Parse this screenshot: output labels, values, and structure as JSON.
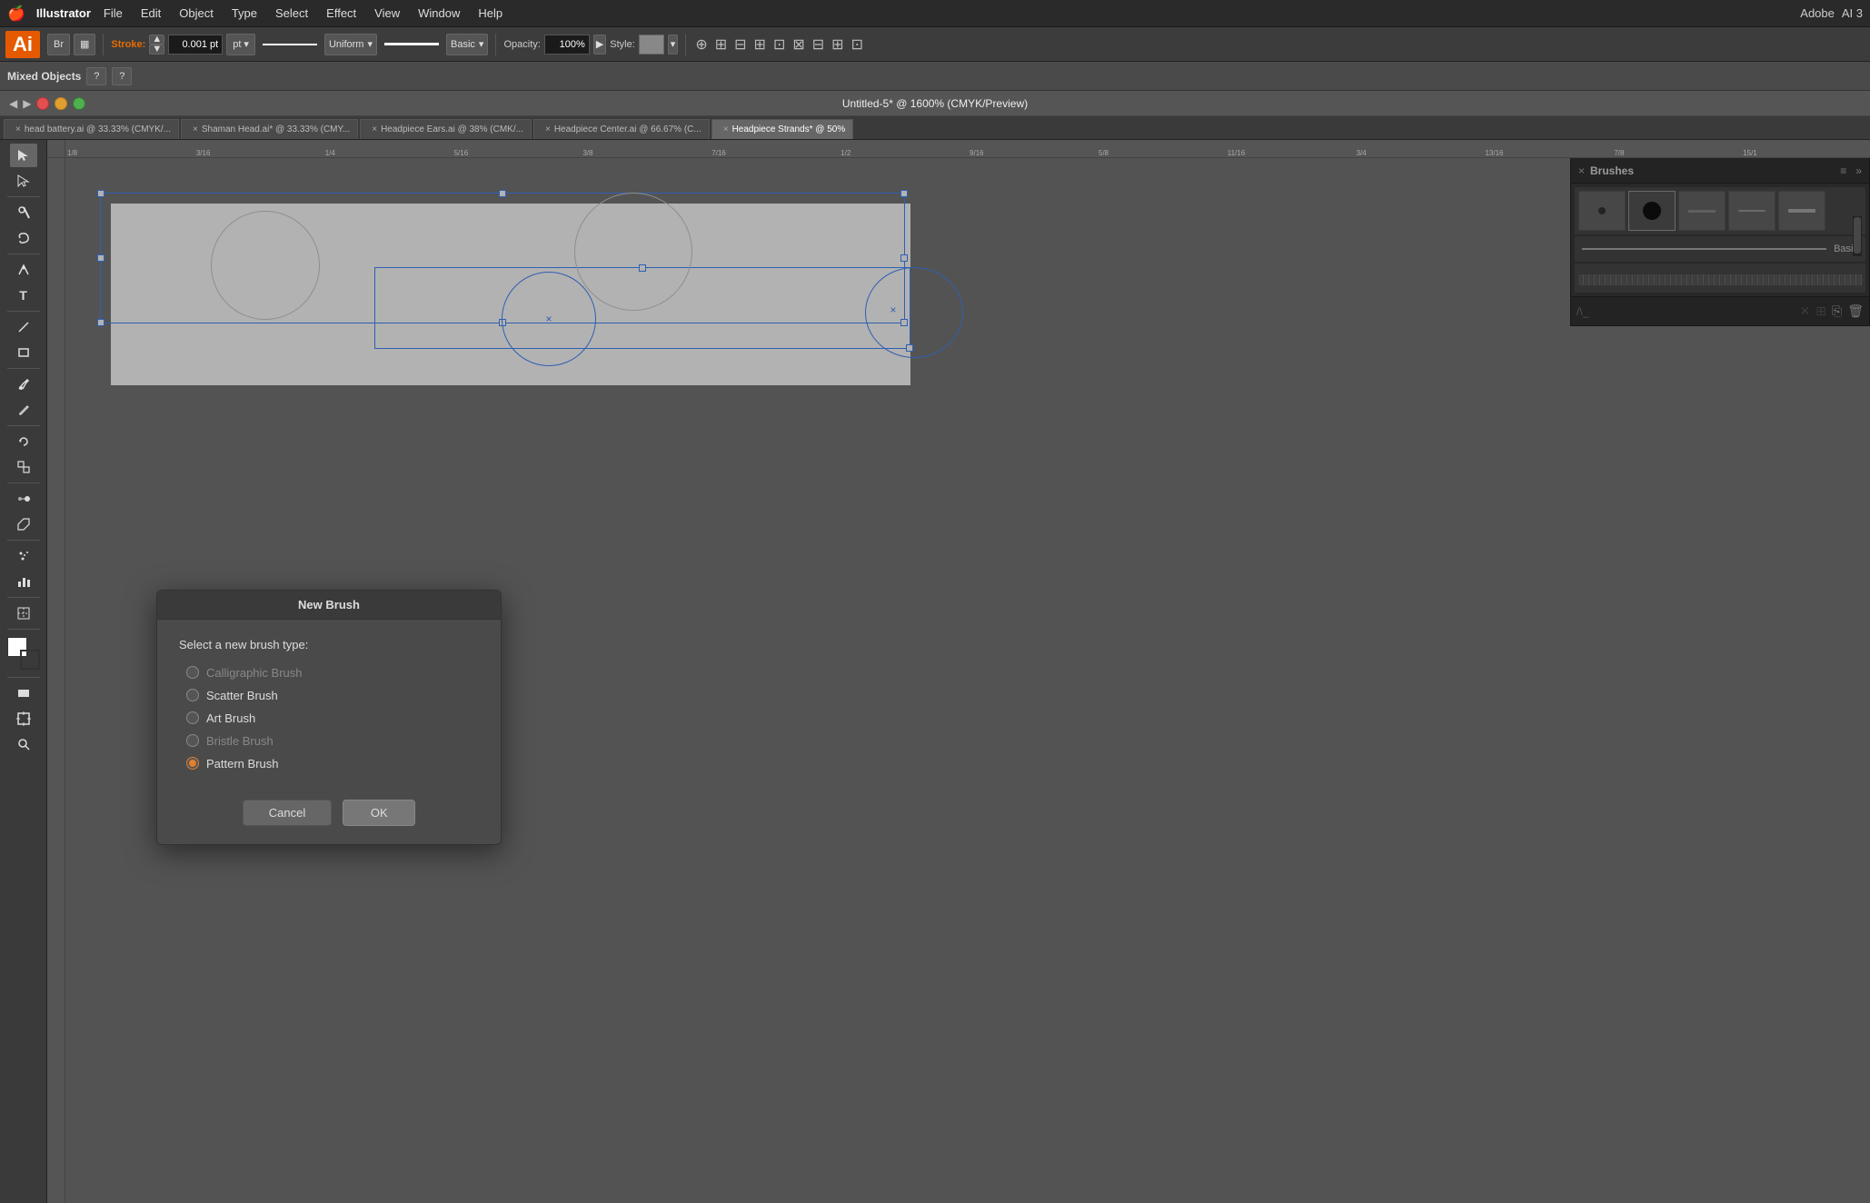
{
  "app": {
    "name": "Illustrator",
    "version": "AI 3",
    "logo": "Ai"
  },
  "menubar": {
    "apple": "🍎",
    "app_name": "Illustrator",
    "items": [
      "File",
      "Edit",
      "Object",
      "Type",
      "Select",
      "Effect",
      "View",
      "Window",
      "Help"
    ]
  },
  "toolbar": {
    "bridge_label": "Br",
    "workspace_label": "▦",
    "stroke_label": "Stroke:",
    "stroke_value": "0.001 pt",
    "stroke_up": "▲",
    "stroke_down": "▼",
    "uniform_label": "Uniform",
    "basic_label": "Basic",
    "opacity_label": "Opacity:",
    "opacity_value": "100%",
    "style_label": "Style:",
    "question_mark": "?",
    "align_icons": [
      "⊞",
      "⊟",
      "⊡",
      "⊠",
      "⊟"
    ]
  },
  "controlbar": {
    "mixed_objects": "Mixed Objects",
    "q1": "?",
    "q2": "?"
  },
  "titlebar": {
    "title": "Untitled-5* @ 1600% (CMYK/Preview)",
    "arrows_left": "◀",
    "arrows_right": "▶"
  },
  "tabs": [
    {
      "label": "head battery.ai @ 33.33% (CMYK/...",
      "modified": false,
      "active": false
    },
    {
      "label": "Shaman Head.ai* @ 33.33% (CMY...",
      "modified": true,
      "active": false
    },
    {
      "label": "Headpiece Ears.ai @ 38% (CMK/...",
      "modified": false,
      "active": false
    },
    {
      "label": "Headpiece Center.ai @ 66.67% (C...",
      "modified": false,
      "active": false
    },
    {
      "label": "Headpiece Strands* @ 50%",
      "modified": true,
      "active": true
    }
  ],
  "ruler": {
    "top_ticks": [
      "1/8",
      "3/16",
      "1/4",
      "5/16",
      "3/8",
      "7/16",
      "1/2",
      "9/16",
      "5/8",
      "11/16",
      "3/4",
      "13/16",
      "7/8",
      "15/1"
    ],
    "left_ticks": []
  },
  "brushes_panel": {
    "title": "Brushes",
    "brush_items": [
      {
        "type": "dot-sm",
        "label": ""
      },
      {
        "type": "dot-lg",
        "label": ""
      },
      {
        "type": "dash",
        "label": ""
      },
      {
        "type": "dash-thin",
        "label": ""
      },
      {
        "type": "stroke",
        "label": ""
      }
    ],
    "basic_line_label": "Basic",
    "new_brush_icon": "📄",
    "delete_icon": "🗑"
  },
  "dialog": {
    "title": "New Brush",
    "prompt": "Select a new brush type:",
    "options": [
      {
        "label": "Calligraphic Brush",
        "enabled": false,
        "selected": false
      },
      {
        "label": "Scatter Brush",
        "enabled": true,
        "selected": false
      },
      {
        "label": "Art Brush",
        "enabled": true,
        "selected": false
      },
      {
        "label": "Bristle Brush",
        "enabled": false,
        "selected": false
      },
      {
        "label": "Pattern Brush",
        "enabled": true,
        "selected": true
      }
    ],
    "cancel_label": "Cancel",
    "ok_label": "OK"
  },
  "tools": [
    "↖",
    "↖",
    "✂",
    "⬡",
    "✏",
    "T",
    "/",
    "□",
    "✏",
    "💧",
    "✏",
    "⟲",
    "⊞",
    "⟲",
    "≋",
    "◉",
    "✂",
    "✂"
  ]
}
